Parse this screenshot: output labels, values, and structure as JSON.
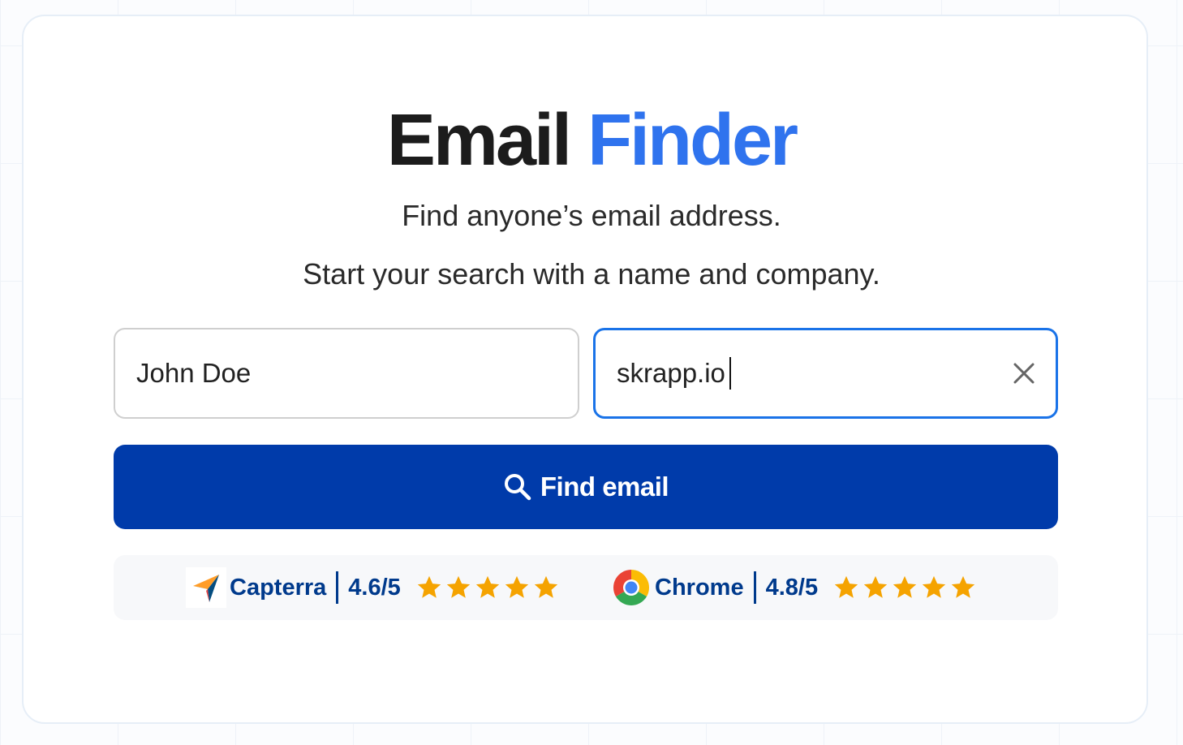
{
  "header": {
    "title_main": "Email",
    "title_accent": "Finder",
    "subtitle_1": "Find anyone’s email address.",
    "subtitle_2": "Start your search with a name and company."
  },
  "form": {
    "name_value": "John Doe",
    "company_value": "skrapp.io",
    "clear_icon": "close-icon",
    "submit_label": "Find email",
    "submit_icon": "search-icon"
  },
  "ratings": [
    {
      "brand": "Capterra",
      "score": "4.6/5",
      "stars": 5,
      "icon": "capterra-logo-icon"
    },
    {
      "brand": "Chrome",
      "score": "4.8/5",
      "stars": 5,
      "icon": "chrome-logo-icon"
    }
  ],
  "colors": {
    "accent": "#2f73ee",
    "button": "#003baa",
    "focus_border": "#1a73e8",
    "rating_text": "#003a8c",
    "star": "#f5a300"
  }
}
